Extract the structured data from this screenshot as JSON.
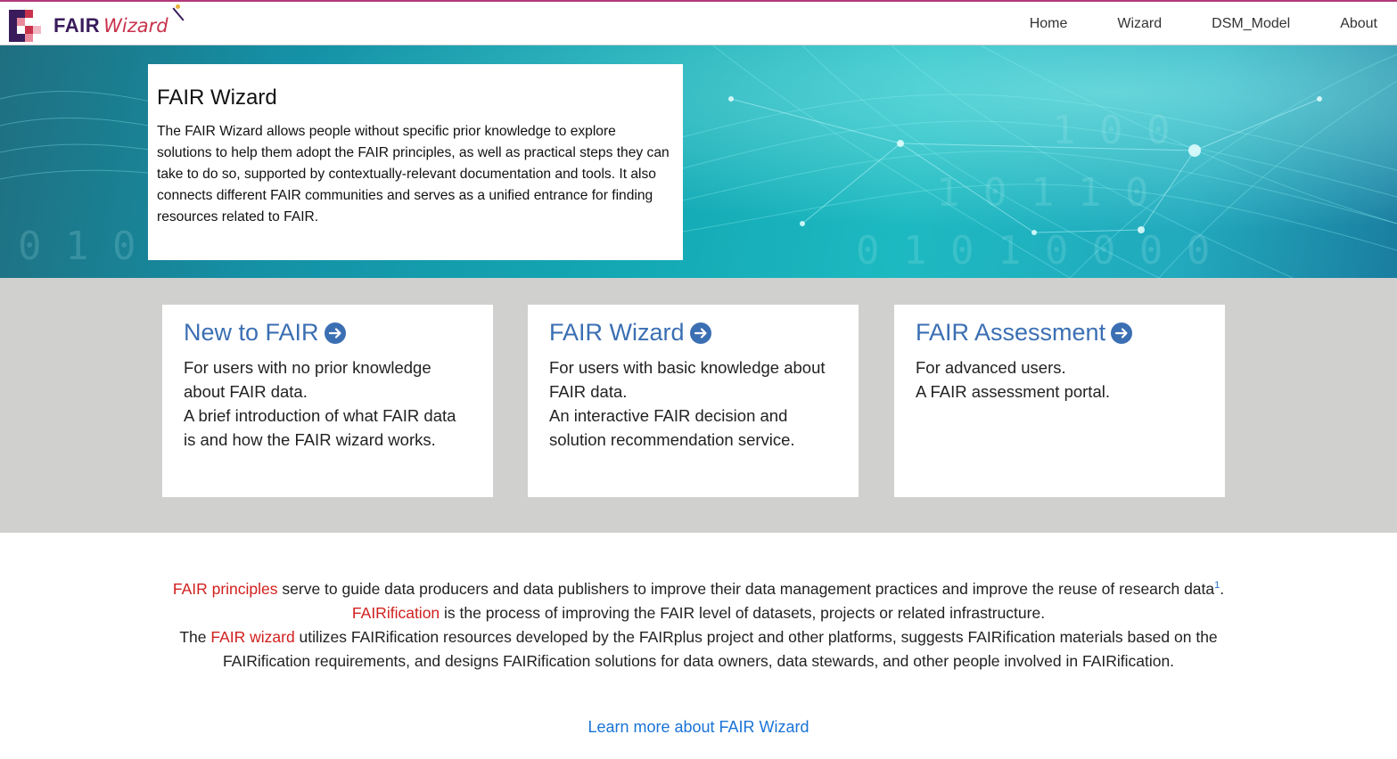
{
  "brand": {
    "fair": "FAIR",
    "wizard": "Wizard",
    "logo_icon": "pixel-grid-logo"
  },
  "nav": {
    "items": [
      {
        "label": "Home"
      },
      {
        "label": "Wizard"
      },
      {
        "label": "DSM_Model"
      },
      {
        "label": "About"
      }
    ]
  },
  "hero": {
    "title": "FAIR Wizard",
    "text": "The FAIR Wizard allows people without specific prior knowledge to explore solutions to help them adopt the FAIR principles, as well as practical steps they can take to do so, supported by contextually-relevant documentation and tools. It also connects different FAIR communities and serves as a unified entrance for finding resources related to FAIR."
  },
  "cards": [
    {
      "title": "New to FAIR",
      "line1": "For users with no prior knowledge about FAIR data.",
      "line2": "A brief introduction of what FAIR data is and how the FAIR wizard works."
    },
    {
      "title": "FAIR Wizard",
      "line1": "For users with basic knowledge about FAIR data.",
      "line2": "An interactive FAIR decision and solution recommendation service."
    },
    {
      "title": "FAIR Assessment",
      "line1": "For advanced users.",
      "line2": "A FAIR assessment portal."
    }
  ],
  "info": {
    "p1_link": "FAIR principles",
    "p1_text": " serve to guide data producers and data publishers to improve their data management practices and improve the reuse of research data",
    "p1_sup": "1",
    "p1_end": ".",
    "p2_link": "FAIRification",
    "p2_text": " is the process of improving the FAIR level of datasets, projects or related infrastructure.",
    "p3_pre": "The ",
    "p3_link": "FAIR wizard",
    "p3_text": " utilizes FAIRification resources developed by the FAIRplus project and other platforms, suggests FAIRification materials based on the",
    "p4_text": "FAIRification requirements, and designs FAIRification solutions for data owners, data stewards, and other people involved in FAIRification.",
    "learn_more": "Learn more about FAIR Wizard"
  },
  "colors": {
    "accent_blue": "#3b6fb3",
    "link_red": "#d0201e",
    "link_blue": "#1a73d6",
    "brand_purple": "#3a1c5c"
  }
}
